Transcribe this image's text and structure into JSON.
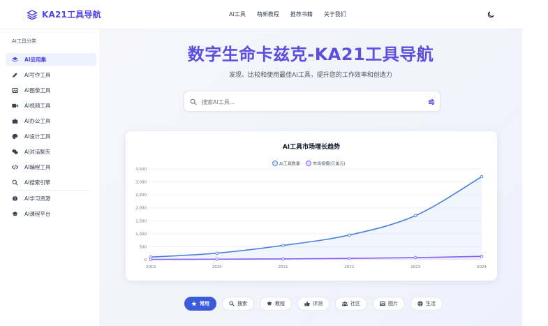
{
  "header": {
    "logo_text": "KA21工具导航",
    "nav": [
      "AI工具",
      "萌新教程",
      "推荐书籍",
      "关于我们"
    ]
  },
  "sidebar": {
    "title": "AI工具分类",
    "items": [
      {
        "label": "AI应用集",
        "icon": "layers-icon",
        "active": true
      },
      {
        "label": "AI写作工具",
        "icon": "pen-icon"
      },
      {
        "label": "AI图像工具",
        "icon": "image-icon"
      },
      {
        "label": "AI视频工具",
        "icon": "video-icon"
      },
      {
        "label": "AI办公工具",
        "icon": "briefcase-icon"
      },
      {
        "label": "AI设计工具",
        "icon": "palette-icon"
      },
      {
        "label": "AI对话聊天",
        "icon": "chat-icon"
      },
      {
        "label": "AI编程工具",
        "icon": "code-icon"
      },
      {
        "label": "AI搜索引擎",
        "icon": "search-icon"
      },
      {
        "label": "AI学习资源",
        "icon": "brain-icon"
      },
      {
        "label": "AI课程平台",
        "icon": "graduation-cap-icon"
      }
    ]
  },
  "hero": {
    "title": "数字生命卡兹克-KA21工具导航",
    "subtitle": "发现、比较和使用最佳AI工具，提升您的工作效率和创造力"
  },
  "search": {
    "placeholder": "搜索AI工具..."
  },
  "chart_data": {
    "type": "line",
    "title": "AI工具市场增长趋势",
    "x": [
      "2019",
      "2020",
      "2021",
      "2022",
      "2023",
      "2024"
    ],
    "yticks": [
      "0",
      "500",
      "1,000",
      "1,500",
      "2,000",
      "2,500",
      "3,000",
      "3,500"
    ],
    "ylim": [
      0,
      3500
    ],
    "grid": true,
    "legend_position": "top-center",
    "series": [
      {
        "name": "AI工具数量",
        "values": [
          100,
          250,
          550,
          950,
          1700,
          3200
        ],
        "color": "#4a7fe0"
      },
      {
        "name": "市场规模(亿美元)",
        "values": [
          10,
          20,
          30,
          50,
          80,
          130
        ],
        "color": "#8b5cf6"
      }
    ]
  },
  "tags": [
    {
      "label": "常用",
      "icon": "star-icon",
      "active": true
    },
    {
      "label": "搜索",
      "icon": "search-icon"
    },
    {
      "label": "教程",
      "icon": "graduation-cap-icon"
    },
    {
      "label": "评测",
      "icon": "thumbs-up-icon"
    },
    {
      "label": "社区",
      "icon": "users-icon"
    },
    {
      "label": "图片",
      "icon": "image-icon"
    },
    {
      "label": "生活",
      "icon": "life-ring-icon"
    }
  ],
  "colors": {
    "accent": "#4f46e5",
    "tag_active": "#3b5bdb"
  }
}
